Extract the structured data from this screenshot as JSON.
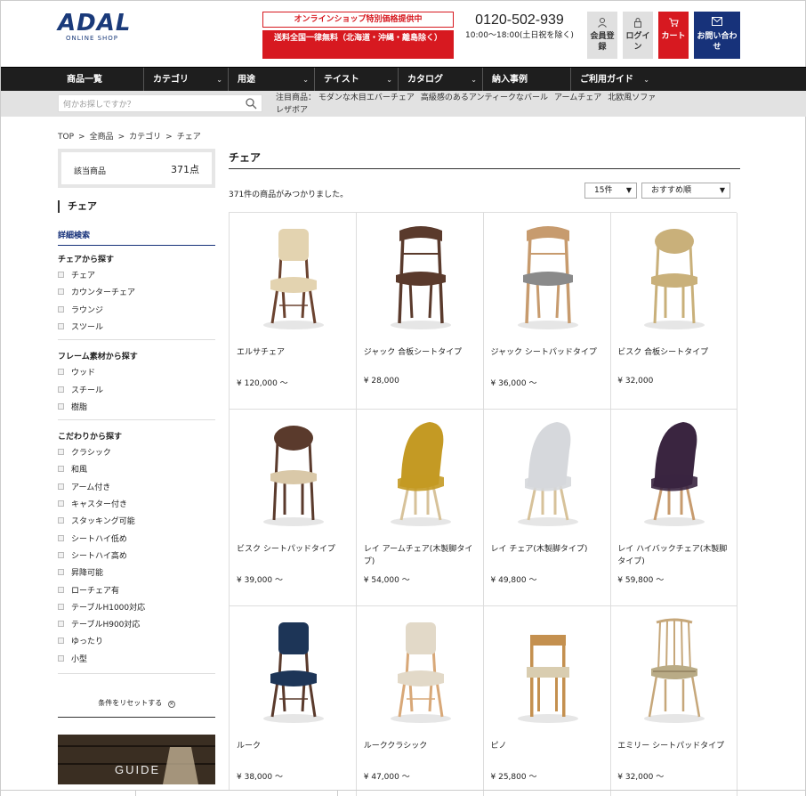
{
  "header": {
    "logo_text": "ADAL",
    "logo_sub": "ONLINE SHOP",
    "promo_top": "オンラインショップ特別価格提供中",
    "promo_bottom": "送料全国一律無料（北海道・沖縄・離島除く）",
    "phone": "0120-502-939",
    "hours": "10:00～18:00(土日祝を除く)",
    "buttons": {
      "member": "会員登録",
      "login": "ログイン",
      "cart": "カート",
      "contact": "お問い合わせ"
    }
  },
  "nav": {
    "items": [
      {
        "label": "商品一覧",
        "dropdown": false
      },
      {
        "label": "カテゴリ",
        "dropdown": true
      },
      {
        "label": "用途",
        "dropdown": true
      },
      {
        "label": "テイスト",
        "dropdown": true
      },
      {
        "label": "カタログ",
        "dropdown": true
      },
      {
        "label": "納入事例",
        "dropdown": false
      },
      {
        "label": "ご利用ガイド",
        "dropdown": true
      }
    ]
  },
  "search": {
    "placeholder": "何かお探しですか？"
  },
  "featured": {
    "label": "注目商品：",
    "items": [
      "モダンな木目エバーチェア",
      "高級感のあるアンティークなバール",
      "アームチェア",
      "北欧風ソファレザボア"
    ]
  },
  "breadcrumb": [
    "TOP",
    ">",
    "全商品",
    ">",
    "カテゴリ",
    ">",
    "チェア"
  ],
  "sidebar": {
    "count_label": "該当商品",
    "count_value": "371点",
    "category_title": "チェア",
    "advanced_search": "詳細検索",
    "groups": [
      {
        "title": "チェアから探す",
        "options": [
          "チェア",
          "カウンターチェア",
          "ラウンジ",
          "スツール"
        ]
      },
      {
        "title": "フレーム素材から探す",
        "options": [
          "ウッド",
          "スチール",
          "樹脂"
        ]
      },
      {
        "title": "こだわりから探す",
        "options": [
          "クラシック",
          "和風",
          "アーム付き",
          "キャスター付き",
          "スタッキング可能",
          "シートハイ低め",
          "シートハイ高め",
          "昇降可能",
          "ローチェア有",
          "テーブルH1000対応",
          "テーブルH900対応",
          "ゆったり",
          "小型"
        ]
      }
    ],
    "reset_label": "条件をリセットする",
    "guide_label": "GUIDE"
  },
  "main": {
    "title": "チェア",
    "found_text": "371件の商品がみつかりました。",
    "per_page": "15件",
    "sort": "おすすめ順"
  },
  "products": [
    {
      "name": "エルサチェア",
      "price": "¥ 120,000 ～",
      "frame": "#6b4330",
      "seat": "#e3d3b0",
      "style": "upholstered"
    },
    {
      "name": "ジャック 合板シートタイプ",
      "price": "¥ 28,000",
      "frame": "#5a3a2c",
      "seat": "#5a3a2c",
      "style": "curvedback"
    },
    {
      "name": "ジャック シートパッドタイプ",
      "price": "¥ 36,000 ～",
      "frame": "#c79b6e",
      "seat": "#8a8a8a",
      "style": "curvedback"
    },
    {
      "name": "ビスク 合板シートタイプ",
      "price": "¥ 32,000",
      "frame": "#c9b07a",
      "seat": "#c9b07a",
      "style": "roundback"
    },
    {
      "name": "ビスク シートパッドタイプ",
      "price": "¥ 39,000 ～",
      "frame": "#5a3a2c",
      "seat": "#d9c8a8",
      "style": "roundback"
    },
    {
      "name": "レイ アームチェア(木製脚タイプ)",
      "price": "¥ 54,000 ～",
      "frame": "#d7c29a",
      "seat": "#c49a24",
      "style": "shell"
    },
    {
      "name": "レイ チェア(木製脚タイプ)",
      "price": "¥ 49,800 ～",
      "frame": "#d7c29a",
      "seat": "#d6d8dc",
      "style": "shell"
    },
    {
      "name": "レイ ハイバックチェア(木製脚タイプ)",
      "price": "¥ 59,800 ～",
      "frame": "#c79b6e",
      "seat": "#3a2540",
      "style": "shell"
    },
    {
      "name": "ルーク",
      "price": "¥ 38,000 ～",
      "frame": "#5a3a2c",
      "seat": "#1d3557",
      "style": "upholstered"
    },
    {
      "name": "ルーククラシック",
      "price": "¥ 47,000 ～",
      "frame": "#d8a878",
      "seat": "#e2d9c8",
      "style": "upholstered"
    },
    {
      "name": "ピノ",
      "price": "¥ 25,800 ～",
      "frame": "#c4904f",
      "seat": "#d9cdb0",
      "style": "simple"
    },
    {
      "name": "エミリー シートパッドタイプ",
      "price": "¥ 32,000 ～",
      "frame": "#c6a77a",
      "seat": "#b9ab86",
      "style": "spindle"
    }
  ]
}
